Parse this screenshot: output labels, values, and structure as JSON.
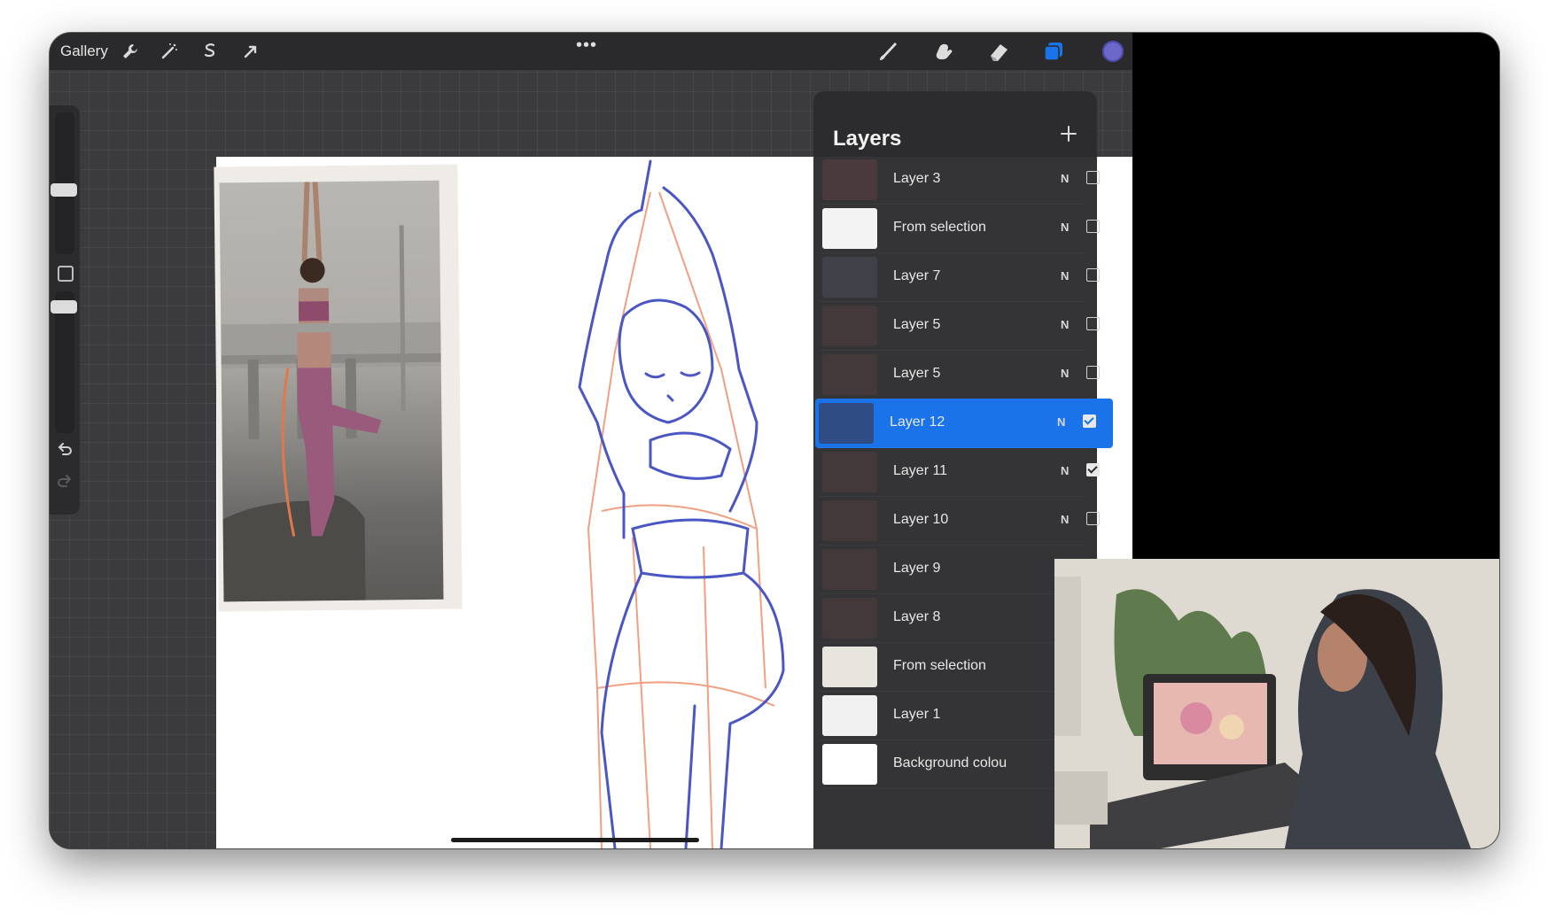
{
  "toolbar": {
    "gallery_label": "Gallery",
    "more_label": "•••",
    "left_tools": [
      "wrench-icon",
      "magic-wand-icon",
      "selection-icon",
      "transform-icon"
    ],
    "right_tools": [
      "brush-icon",
      "smudge-icon",
      "eraser-icon",
      "layers-icon"
    ],
    "active_tool": "layers-icon",
    "accent_color": "#1a73e8",
    "current_color": "#6b68c9"
  },
  "sidebar": {
    "icons": [
      "brush-size-slider",
      "modify-square",
      "opacity-slider",
      "undo-icon",
      "redo-icon"
    ]
  },
  "layers": {
    "title": "Layers",
    "add_icon": "plus-icon",
    "items": [
      {
        "name": "Layer 3",
        "blend": "N",
        "visible": false,
        "active": false
      },
      {
        "name": "From selection",
        "blend": "N",
        "visible": false,
        "active": false
      },
      {
        "name": "Layer 7",
        "blend": "N",
        "visible": false,
        "active": false
      },
      {
        "name": "Layer 5",
        "blend": "N",
        "visible": false,
        "active": false
      },
      {
        "name": "Layer 5",
        "blend": "N",
        "visible": false,
        "active": false
      },
      {
        "name": "Layer 12",
        "blend": "N",
        "visible": true,
        "active": true
      },
      {
        "name": "Layer 11",
        "blend": "N",
        "visible": true,
        "active": false
      },
      {
        "name": "Layer 10",
        "blend": "N",
        "visible": false,
        "active": false
      },
      {
        "name": "Layer 9",
        "blend": "",
        "visible": false,
        "active": false
      },
      {
        "name": "Layer 8",
        "blend": "",
        "visible": false,
        "active": false
      },
      {
        "name": "From selection",
        "blend": "",
        "visible": false,
        "active": false
      },
      {
        "name": "Layer 1",
        "blend": "",
        "visible": false,
        "active": false
      },
      {
        "name": "Background colou",
        "blend": "",
        "visible": false,
        "active": false
      }
    ]
  }
}
